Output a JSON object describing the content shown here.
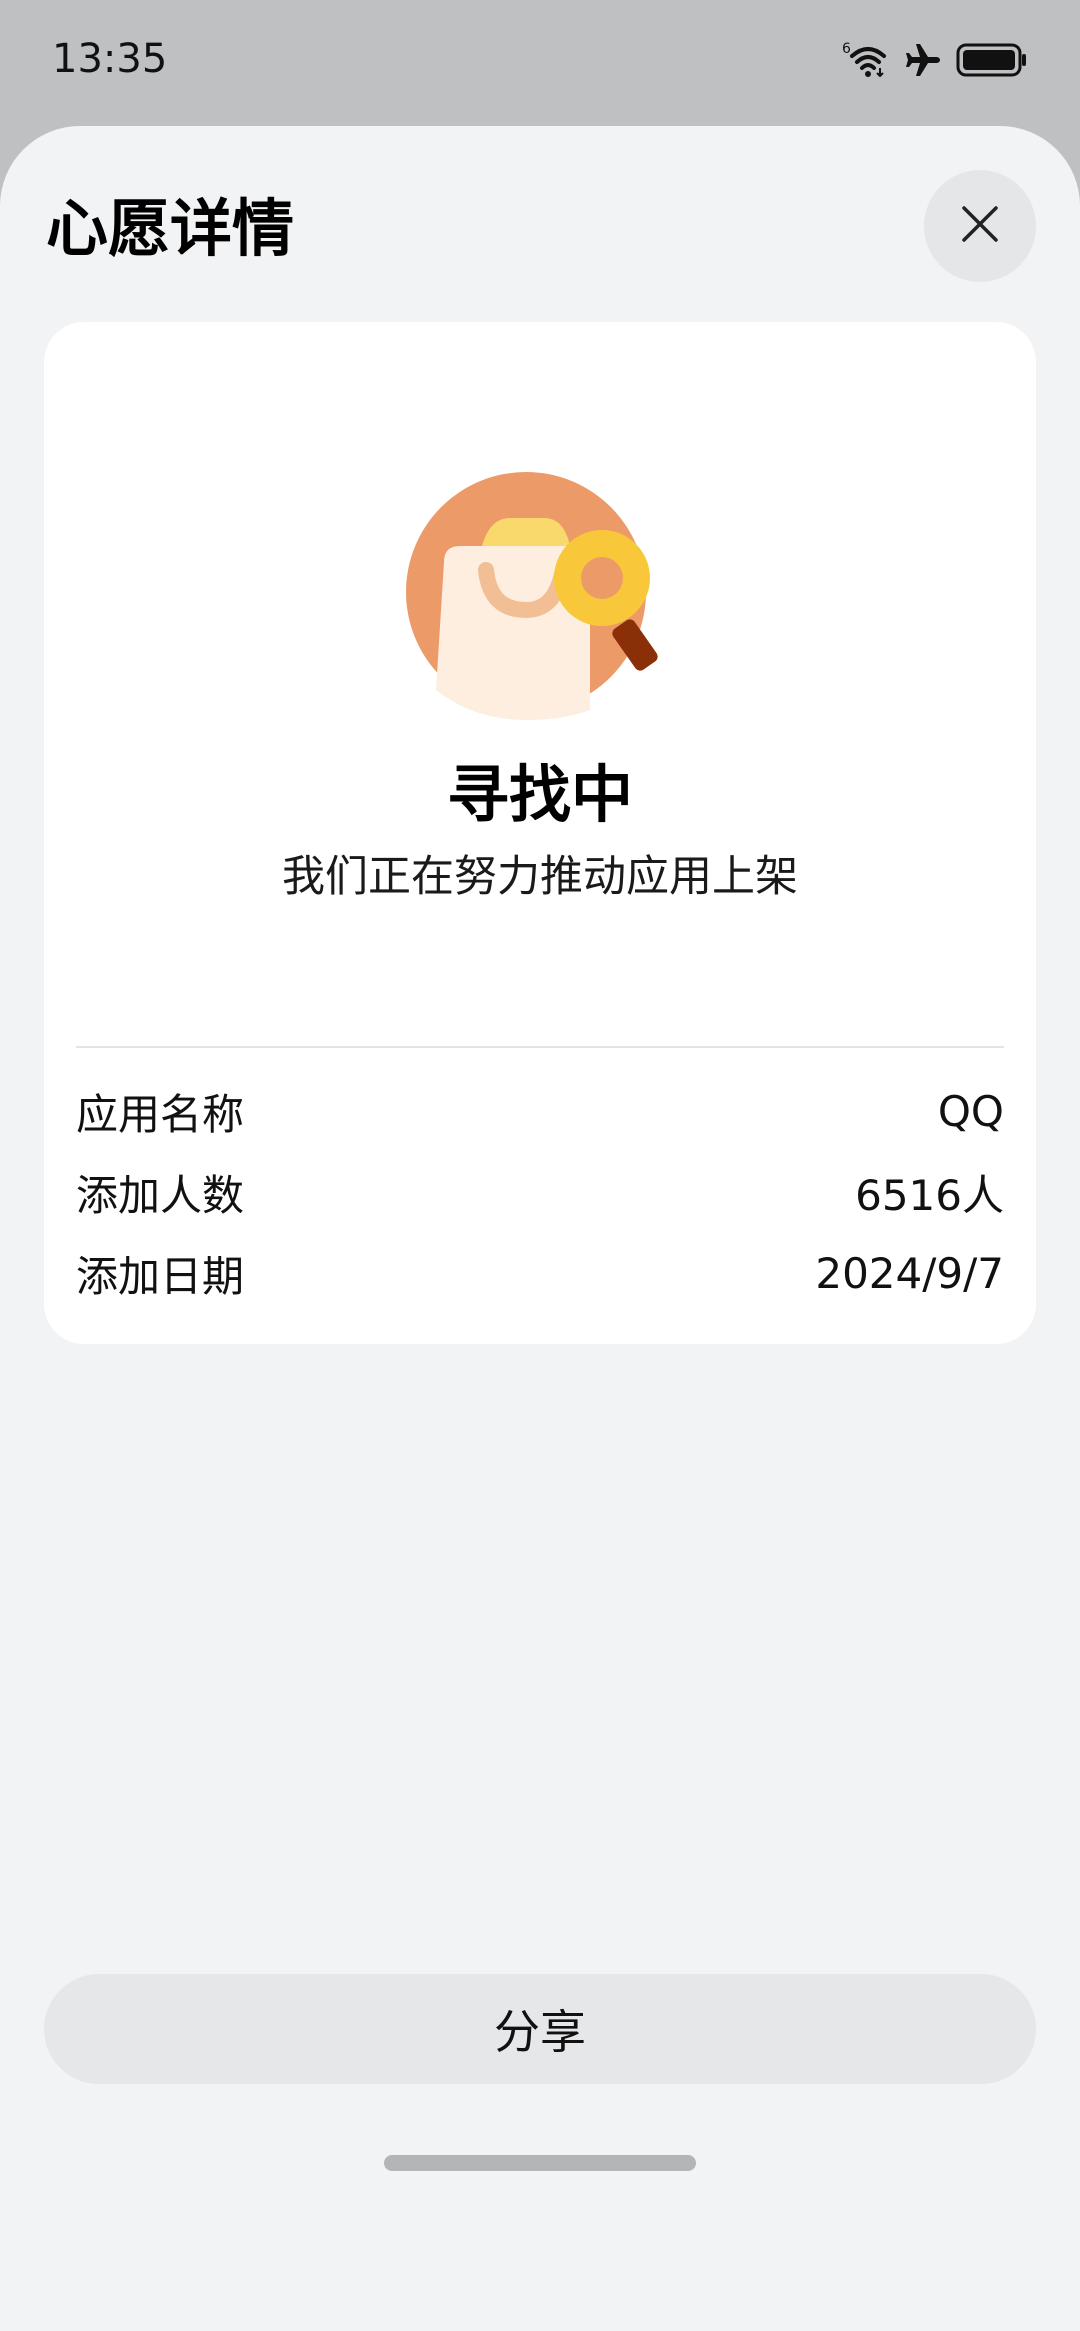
{
  "status_bar": {
    "time": "13:35",
    "icons": [
      "signal-6-icon",
      "wifi-icon",
      "airplane-icon",
      "battery-icon"
    ]
  },
  "sheet": {
    "title": "心愿详情",
    "close_icon": "close-icon"
  },
  "card": {
    "illustration": "searching-bag-illustration",
    "status_title": "寻找中",
    "status_subtitle": "我们正在努力推动应用上架",
    "rows": [
      {
        "label": "应用名称",
        "value": "QQ"
      },
      {
        "label": "添加人数",
        "value": "6516人"
      },
      {
        "label": "添加日期",
        "value": "2024/9/7"
      }
    ]
  },
  "footer": {
    "share_label": "分享"
  },
  "colors": {
    "sheet_background": "#f2f3f5",
    "card_background": "#ffffff",
    "illustration_circle": "#ec9a67",
    "magnifier": "#f8c83a",
    "magnifier_handle": "#8a2f08"
  }
}
